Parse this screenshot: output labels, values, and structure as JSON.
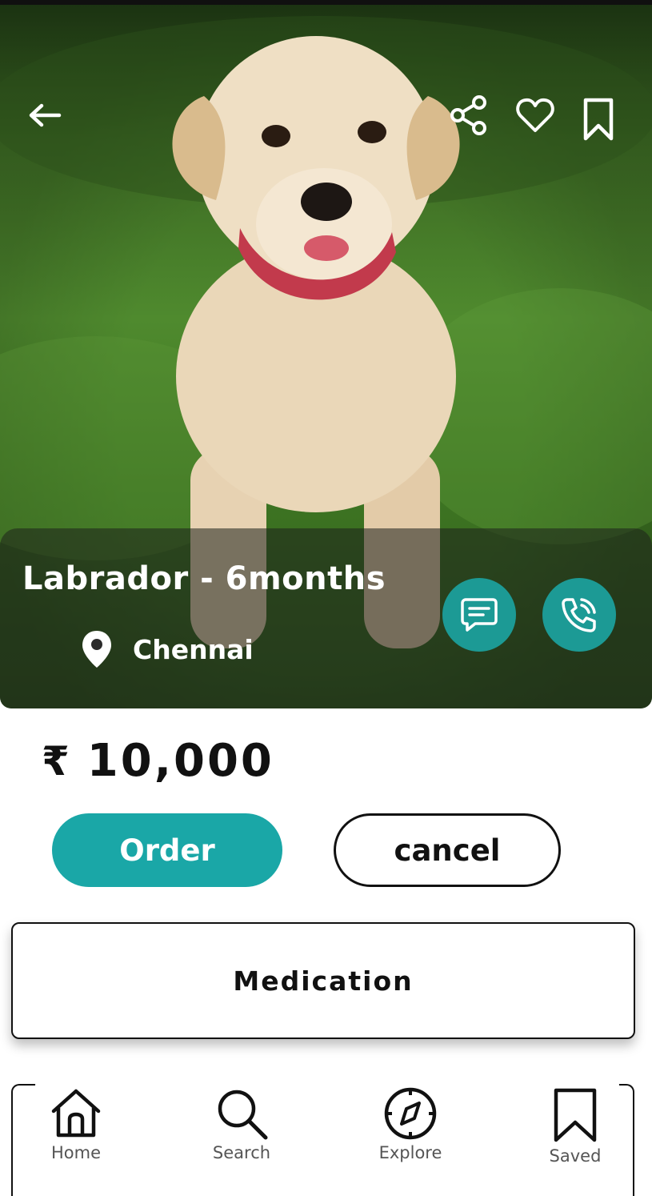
{
  "listing": {
    "title": "Labrador - 6months",
    "location": "Chennai",
    "currency_symbol": "₹",
    "price": "10,000"
  },
  "actions": {
    "order_label": "Order",
    "cancel_label": "cancel"
  },
  "sections": {
    "medication_label": "Medication"
  },
  "nav": {
    "items": [
      {
        "label": "Home",
        "icon": "home-icon"
      },
      {
        "label": "Search",
        "icon": "search-icon"
      },
      {
        "label": "Explore",
        "icon": "compass-icon"
      },
      {
        "label": "Saved",
        "icon": "bookmark-icon"
      }
    ]
  },
  "colors": {
    "accent": "#1aa7a7",
    "round_button": "#1c9a95",
    "text": "#111111"
  }
}
